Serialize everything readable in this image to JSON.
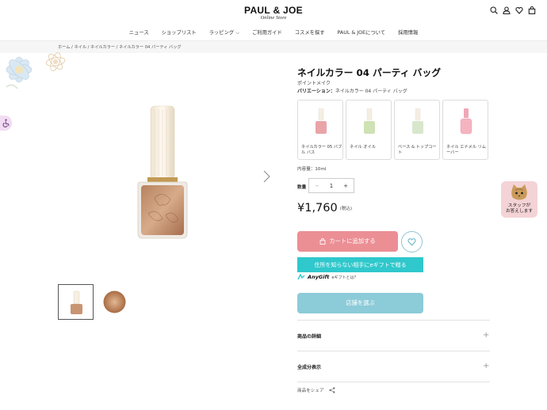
{
  "header": {
    "logo_main": "PAUL & JOE",
    "logo_sub": "Online Store",
    "icons": [
      "search-icon",
      "user-icon",
      "heart-icon",
      "bag-icon"
    ]
  },
  "nav": {
    "items": [
      "ニュース",
      "ショップリスト",
      "ラッピング ⌵",
      "ご利用ガイド",
      "コスメを探す",
      "PAUL & JOEについて",
      "採用情報"
    ]
  },
  "breadcrumb": "ホーム / ネイル / ネイルカラー / ネイルカラー 04 パーティ バッグ",
  "product": {
    "title": "ネイルカラー 04 パーティ バッグ",
    "category": "ポイントメイク",
    "variation_label": "バリエーション：",
    "variation_value": "ネイルカラー 04 パーティ バッグ",
    "related": [
      {
        "name": "ネイルカラー 05 バブル バス",
        "color": "#e9a4a8"
      },
      {
        "name": "ネイル オイル",
        "color": "#cfe2b4"
      },
      {
        "name": "ベース & トップコート",
        "color": "#d8e7cc"
      },
      {
        "name": "ネイル エナメル リムーバー",
        "color": "#f0a7b6"
      }
    ],
    "volume": "内容量：10ml",
    "qty_label": "数量",
    "qty_minus": "−",
    "qty_value": "1",
    "qty_plus": "+",
    "price": "¥1,760",
    "tax": "(税込)",
    "cart_label": "カートに追加する",
    "gift_label": "住所を知らない相手にeギフトで贈る",
    "anygift": "AnyGift",
    "anygift_q": "eギフトとは？",
    "store_label": "店舗を選ぶ",
    "accordion": [
      "商品の詳細",
      "全成分表示"
    ],
    "accordion_icon": "+",
    "share": "商品をシェア"
  },
  "staff_widget": {
    "line1": "スタッフが",
    "line2": "お答えします"
  },
  "colors": {
    "cart": "#eb8f95",
    "gift": "#2fc8cc",
    "store": "#8ccbd8",
    "accent_pink": "#f4d3d6"
  }
}
